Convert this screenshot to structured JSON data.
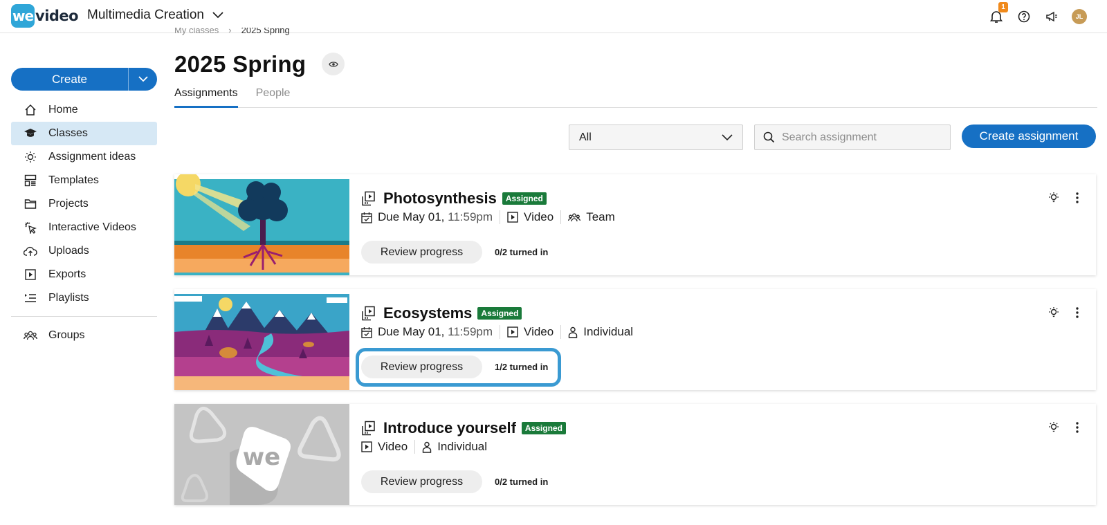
{
  "header": {
    "logo_mark": "we",
    "logo_text": "video",
    "workspace": "Multimedia Creation",
    "notification_count": "1",
    "avatar_initials": "JL"
  },
  "breadcrumb": {
    "parent": "My classes",
    "current": "2025 Spring"
  },
  "sidebar": {
    "create_label": "Create",
    "items": [
      {
        "label": "Home",
        "icon": "home-icon"
      },
      {
        "label": "Classes",
        "icon": "graduation-cap-icon",
        "active": true
      },
      {
        "label": "Assignment ideas",
        "icon": "lightbulb-icon"
      },
      {
        "label": "Templates",
        "icon": "templates-icon"
      },
      {
        "label": "Projects",
        "icon": "folder-icon"
      },
      {
        "label": "Interactive Videos",
        "icon": "pointer-click-icon"
      },
      {
        "label": "Uploads",
        "icon": "cloud-upload-icon"
      },
      {
        "label": "Exports",
        "icon": "export-play-icon"
      },
      {
        "label": "Playlists",
        "icon": "playlist-icon"
      },
      {
        "label": "Groups",
        "icon": "group-icon"
      }
    ]
  },
  "page": {
    "title": "2025 Spring"
  },
  "tabs": [
    {
      "label": "Assignments",
      "active": true
    },
    {
      "label": "People",
      "active": false
    }
  ],
  "toolbar": {
    "filter_value": "All",
    "search_placeholder": "Search assignment",
    "create_assignment_label": "Create assignment"
  },
  "assignments": [
    {
      "title": "Photosynthesis",
      "status": "Assigned",
      "due_prefix": "Due May 01,",
      "due_time": "11:59pm",
      "type": "Video",
      "mode": "Team",
      "review_label": "Review progress",
      "turned_in": "0/2 turned in"
    },
    {
      "title": "Ecosystems",
      "status": "Assigned",
      "due_prefix": "Due May 01,",
      "due_time": "11:59pm",
      "type": "Video",
      "mode": "Individual",
      "review_label": "Review progress",
      "turned_in": "1/2 turned in"
    },
    {
      "title": "Introduce yourself",
      "status": "Assigned",
      "type": "Video",
      "mode": "Individual",
      "review_label": "Review progress",
      "turned_in": "0/2 turned in",
      "thumb_logo": "we"
    }
  ],
  "colors": {
    "primary": "#1670c4",
    "badge_green": "#1a7a3a",
    "highlight": "#3a9ad2",
    "notification": "#f08a1c"
  }
}
